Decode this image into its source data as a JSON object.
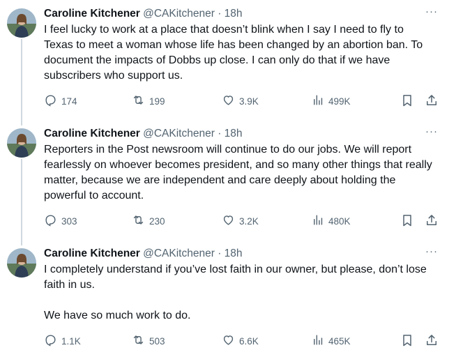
{
  "tweets": [
    {
      "name": "Caroline Kitchener",
      "handle": "@CAKitchener",
      "separator": "·",
      "time": "18h",
      "more": "···",
      "text": "I feel lucky to work at a place that doesn’t blink when I say I need to fly to Texas to meet a woman whose life has been changed by an abortion ban. To document the impacts of Dobbs up close. I can only do that if we have subscribers who support us.",
      "replies": "174",
      "reposts": "199",
      "likes": "3.9K",
      "views": "499K"
    },
    {
      "name": "Caroline Kitchener",
      "handle": "@CAKitchener",
      "separator": "·",
      "time": "18h",
      "more": "···",
      "text": "Reporters in the Post newsroom will continue to do our jobs. We will report fearlessly on whoever becomes president, and so many other things that really matter, because we are independent and care deeply about holding the powerful to account.",
      "replies": "303",
      "reposts": "230",
      "likes": "3.2K",
      "views": "480K"
    },
    {
      "name": "Caroline Kitchener",
      "handle": "@CAKitchener",
      "separator": "·",
      "time": "18h",
      "more": "···",
      "text": "I completely understand if you’ve lost faith in our owner, but please, don’t lose faith in us.\n\nWe have so much work to do.",
      "replies": "1.1K",
      "reposts": "503",
      "likes": "6.6K",
      "views": "465K"
    }
  ],
  "colors": {
    "text": "#0f1419",
    "muted": "#536471",
    "thread_line": "#cfd9de"
  },
  "icons": [
    "reply-icon",
    "repost-icon",
    "like-icon",
    "views-icon",
    "bookmark-icon",
    "share-icon",
    "more-icon"
  ]
}
